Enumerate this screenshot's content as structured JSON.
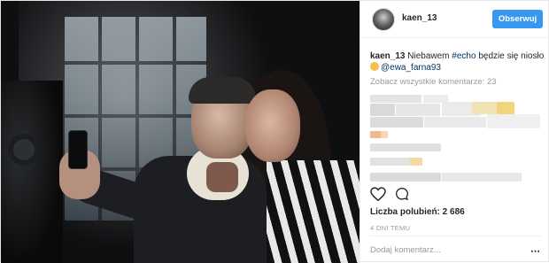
{
  "post": {
    "username": "kaen_13",
    "follow_label": "Obserwuj",
    "caption": {
      "username": "kaen_13",
      "text_before": " Niebawem ",
      "hashtag": "#echo",
      "text_after": " będzie się niosło ",
      "mention": "@ewa_farna93"
    },
    "view_all_comments": "Zobacz wszystkie komentarze: 23",
    "likes_text": "Liczba polubień: 2 686",
    "timestamp": "4 DNI TEMU",
    "comment_placeholder": "Dodaj komentarz...",
    "more_icon": "⋯"
  },
  "icons": {
    "heart": "heart-icon",
    "comment": "comment-icon",
    "more": "more-options-icon"
  },
  "colors": {
    "accent": "#3897f0",
    "link": "#003569",
    "muted": "#999999",
    "text": "#262626"
  }
}
